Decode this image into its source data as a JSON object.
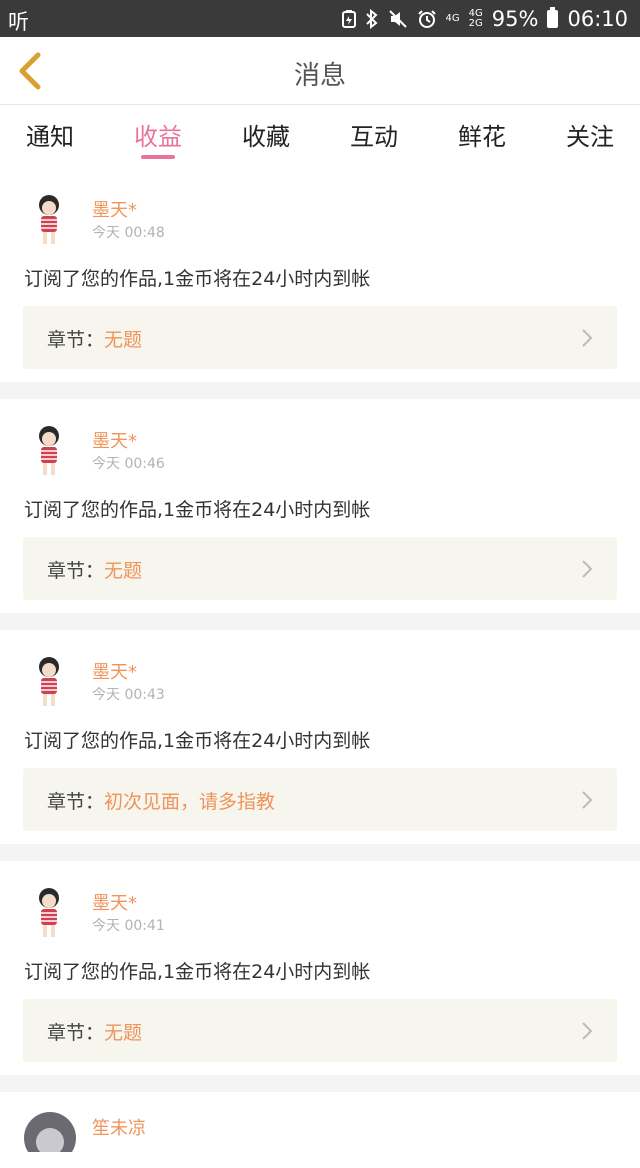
{
  "status_bar": {
    "left_label": "听",
    "icons": [
      "battery-saver-icon",
      "bluetooth-icon",
      "mute-icon",
      "alarm-icon"
    ],
    "net1": "4G",
    "net2_top": "4G",
    "net2_bottom": "2G",
    "battery": "95%",
    "time": "06:10"
  },
  "header": {
    "title": "消息",
    "accent": "#d8a030"
  },
  "tabs": [
    {
      "label": "通知"
    },
    {
      "label": "收益",
      "active": true
    },
    {
      "label": "收藏"
    },
    {
      "label": "互动"
    },
    {
      "label": "鲜花"
    },
    {
      "label": "关注"
    }
  ],
  "messages": [
    {
      "user": "墨天*",
      "time": "今天 00:48",
      "text": "订阅了您的作品,1金币将在24小时内到帐",
      "chapter_label": "章节：",
      "chapter_title": "无题"
    },
    {
      "user": "墨天*",
      "time": "今天 00:46",
      "text": "订阅了您的作品,1金币将在24小时内到帐",
      "chapter_label": "章节：",
      "chapter_title": "无题"
    },
    {
      "user": "墨天*",
      "time": "今天 00:43",
      "text": "订阅了您的作品,1金币将在24小时内到帐",
      "chapter_label": "章节：",
      "chapter_title": "初次见面，请多指教"
    },
    {
      "user": "墨天*",
      "time": "今天 00:41",
      "text": "订阅了您的作品,1金币将在24小时内到帐",
      "chapter_label": "章节：",
      "chapter_title": "无题"
    }
  ],
  "partial_message": {
    "user": "笙未凉"
  },
  "colors": {
    "accent": "#e8739c",
    "username": "#f0945a",
    "chapter_bg": "#f6f5ee"
  }
}
